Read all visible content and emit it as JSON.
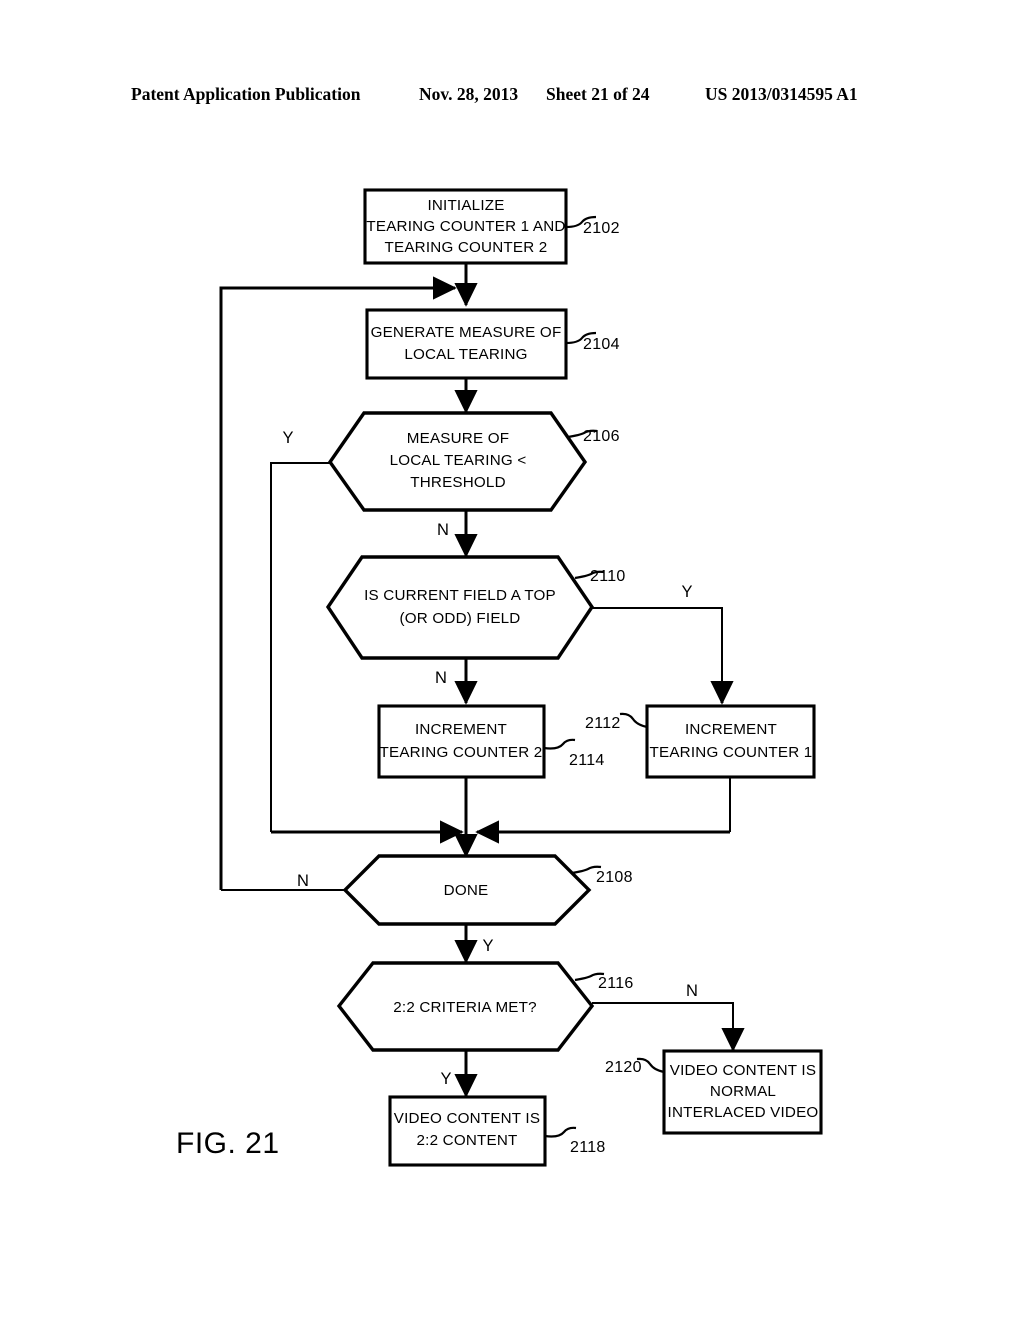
{
  "header": {
    "publication": "Patent Application Publication",
    "date": "Nov. 28, 2013",
    "sheet": "Sheet 21 of 24",
    "patent_number": "US 2013/0314595 A1"
  },
  "figure": {
    "caption": "FIG. 21"
  },
  "nodes": {
    "n2102": {
      "ref": "2102",
      "shape": "process",
      "lines": [
        "INITIALIZE",
        "TEARING COUNTER 1 AND",
        "TEARING COUNTER 2"
      ]
    },
    "n2104": {
      "ref": "2104",
      "shape": "process",
      "lines": [
        "GENERATE MEASURE OF",
        "LOCAL TEARING"
      ]
    },
    "n2106": {
      "ref": "2106",
      "shape": "decision",
      "lines": [
        "MEASURE OF",
        "LOCAL TEARING <",
        "THRESHOLD"
      ]
    },
    "n2110": {
      "ref": "2110",
      "shape": "decision",
      "lines": [
        "IS CURRENT FIELD A TOP",
        "(OR ODD) FIELD"
      ]
    },
    "n2114": {
      "ref": "2114",
      "shape": "process",
      "lines": [
        "INCREMENT",
        "TEARING COUNTER 2"
      ]
    },
    "n2112": {
      "ref": "2112",
      "shape": "process",
      "lines": [
        "INCREMENT",
        "TEARING COUNTER 1"
      ]
    },
    "n2108": {
      "ref": "2108",
      "shape": "decision",
      "lines": [
        "DONE"
      ]
    },
    "n2116": {
      "ref": "2116",
      "shape": "decision",
      "lines": [
        "2:2 CRITERIA MET?"
      ]
    },
    "n2118": {
      "ref": "2118",
      "shape": "process",
      "lines": [
        "VIDEO CONTENT IS",
        "2:2 CONTENT"
      ]
    },
    "n2120": {
      "ref": "2120",
      "shape": "process",
      "lines": [
        "VIDEO CONTENT IS",
        "NORMAL",
        "INTERLACED VIDEO"
      ]
    }
  },
  "branch_labels": {
    "b2106_yes": "Y",
    "b2106_no": "N",
    "b2110_yes": "Y",
    "b2110_no": "N",
    "b2108_no": "N",
    "b2108_yes": "Y",
    "b2116_no": "N",
    "b2116_yes": "Y"
  },
  "colors": {
    "ink": "#000000",
    "paper": "#ffffff"
  }
}
